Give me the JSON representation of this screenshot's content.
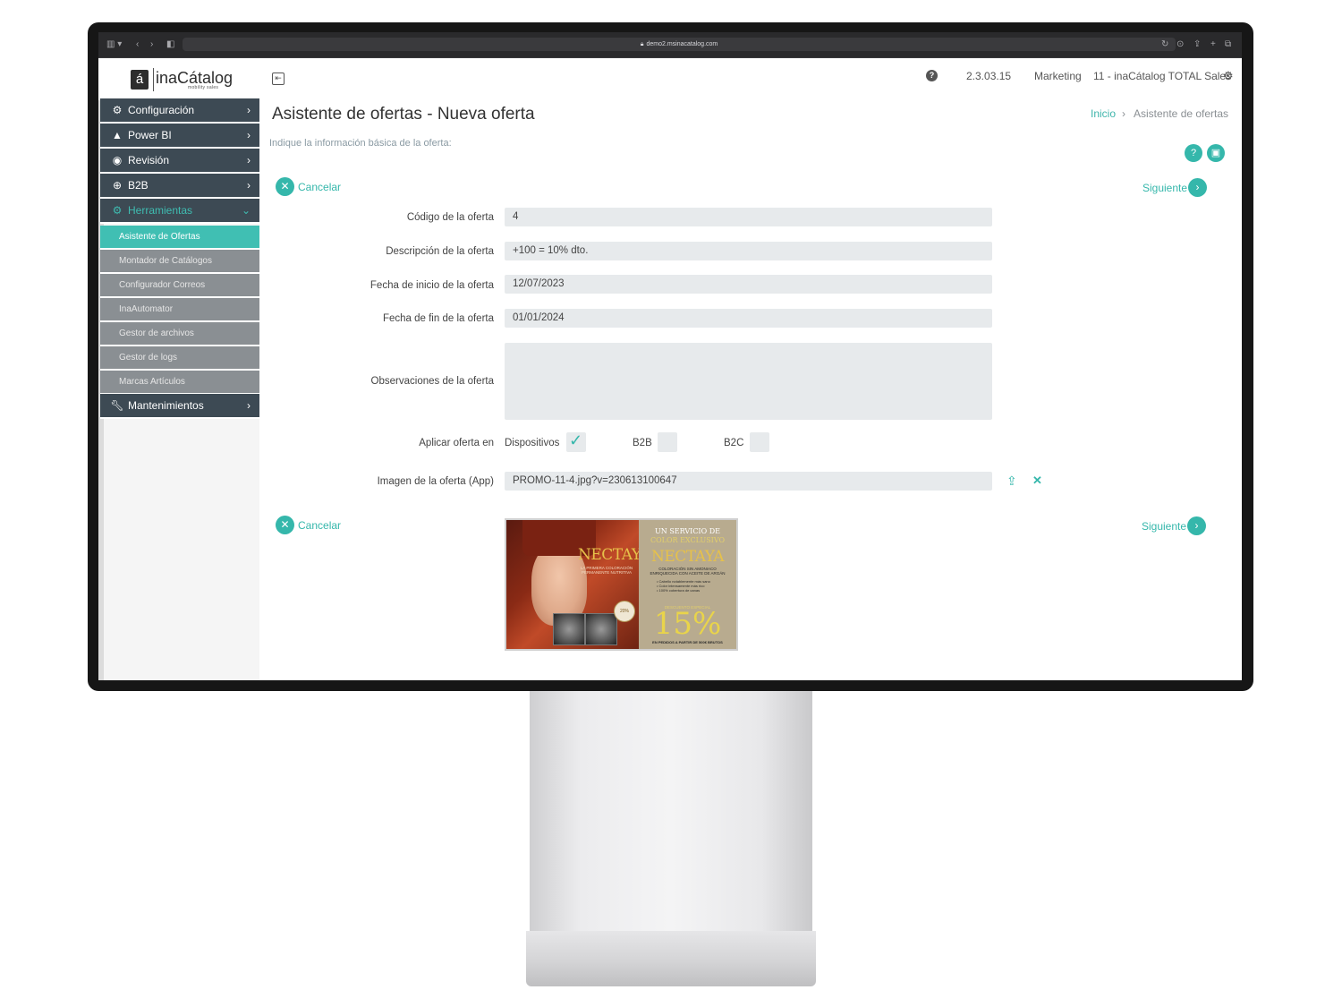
{
  "browser": {
    "url": "demo2.msinacatalog.com",
    "lock_icon": "lock-icon"
  },
  "app": {
    "logo_text": "inaCátalog",
    "logo_letter": "á",
    "logo_sub": "mobility sales",
    "version": "2.3.03.15",
    "department": "Marketing",
    "company": "11 - inaCátalog TOTAL Sales",
    "accent_color": "#35b7ab",
    "menu_color": "#3d4a54"
  },
  "sidebar": {
    "items": [
      {
        "label": "Configuración",
        "icon": "gear-icon"
      },
      {
        "label": "Power BI",
        "icon": "triangle-icon"
      },
      {
        "label": "Revisión",
        "icon": "eye-icon"
      },
      {
        "label": "B2B",
        "icon": "globe-icon"
      },
      {
        "label": "Herramientas",
        "icon": "cogs-icon"
      },
      {
        "label": "Mantenimientos",
        "icon": "wrench-icon"
      }
    ],
    "subitems": [
      {
        "label": "Asistente de Ofertas"
      },
      {
        "label": "Montador de Catálogos"
      },
      {
        "label": "Configurador Correos"
      },
      {
        "label": "InaAutomator"
      },
      {
        "label": "Gestor de archivos"
      },
      {
        "label": "Gestor de logs"
      },
      {
        "label": "Marcas Artículos"
      }
    ]
  },
  "page": {
    "title": "Asistente de ofertas - Nueva oferta",
    "breadcrumb_home": "Inicio",
    "breadcrumb_current": "Asistente de ofertas",
    "intro": "Indique la información básica de la oferta:",
    "cancel_label": "Cancelar",
    "next_label": "Siguiente"
  },
  "form": {
    "code_label": "Código de la oferta",
    "code_value": "4",
    "description_label": "Descripción de la oferta",
    "description_value": "+100 = 10% dto.",
    "start_label": "Fecha de inicio de la oferta",
    "start_value": "12/07/2023",
    "end_label": "Fecha de fin de la oferta",
    "end_value": "01/01/2024",
    "notes_label": "Observaciones de la oferta",
    "notes_value": "",
    "apply_label": "Aplicar oferta en",
    "apply_options": [
      {
        "label": "Dispositivos",
        "checked": true
      },
      {
        "label": "B2B",
        "checked": false
      },
      {
        "label": "B2C",
        "checked": false
      }
    ],
    "image_label": "Imagen de la oferta (App)",
    "image_value": "PROMO-11-4.jpg?v=230613100647"
  },
  "promo_image": {
    "brand": "NECTAYA",
    "left_sub": "LA PRIMERA COLORACIÓN PERMANENTE NUTRITIVA",
    "badge": "20%",
    "right_head1": "UN SERVICIO DE",
    "right_head2": "COLOR EXCLUSIVO",
    "right_sub": "COLORACIÓN SIN AMONIACO ENRIQUECIDA CON ACEITE DE ARGÁN",
    "right_list": [
      "• Cabello notablemente más sano",
      "• Color intensamente más rico",
      "• 100% cobertura de canas"
    ],
    "right_small": "DESCUENTO ESPECIAL",
    "percent": "15%",
    "footer": "EN PEDIDOS A PARTIR DE 500€ BRUTOS"
  }
}
